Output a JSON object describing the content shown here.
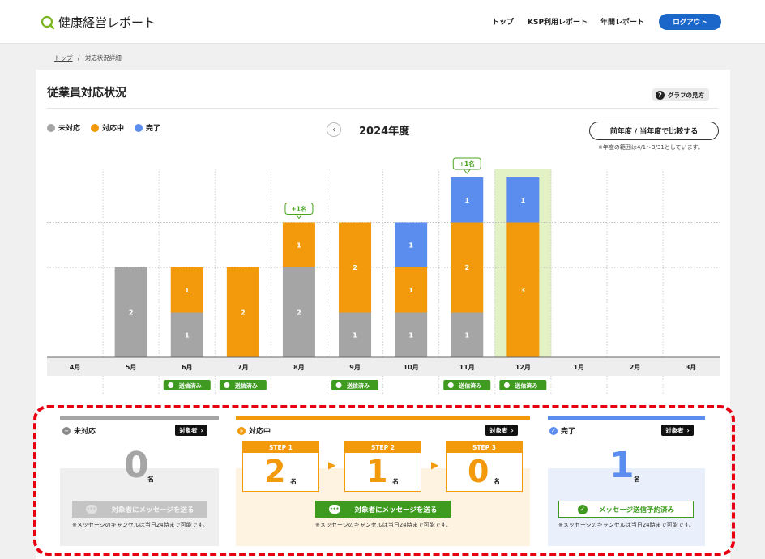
{
  "header": {
    "logo_text": "健康経営レポート",
    "nav": [
      "トップ",
      "KSP利用レポート",
      "年間レポート"
    ],
    "logout_label": "ログアウト"
  },
  "breadcrumb": {
    "top": "トップ",
    "separator": "/",
    "current": "対応状況詳細"
  },
  "page": {
    "title": "従業員対応状況",
    "help_label": "グラフの見方",
    "year_label": "2024年度",
    "compare_label": "前年度 / 当年度で比較する",
    "range_note": "※年度の範囲は4/1～3/31としています。"
  },
  "legend": [
    {
      "label": "未対応",
      "color": "#a5a5a5"
    },
    {
      "label": "対応中",
      "color": "#f29a0c"
    },
    {
      "label": "完了",
      "color": "#5b8def"
    }
  ],
  "chart_data": {
    "type": "bar",
    "stacked": true,
    "categories": [
      "4月",
      "5月",
      "6月",
      "7月",
      "8月",
      "9月",
      "10月",
      "11月",
      "12月",
      "1月",
      "2月",
      "3月"
    ],
    "series": [
      {
        "name": "未対応",
        "color": "#a5a5a5",
        "values": [
          0,
          2,
          1,
          0,
          2,
          1,
          1,
          1,
          0,
          0,
          0,
          0
        ]
      },
      {
        "name": "対応中",
        "color": "#f29a0c",
        "values": [
          0,
          0,
          1,
          2,
          1,
          2,
          1,
          2,
          3,
          0,
          0,
          0
        ]
      },
      {
        "name": "完了",
        "color": "#5b8def",
        "values": [
          0,
          0,
          0,
          0,
          0,
          0,
          1,
          1,
          1,
          0,
          0,
          0
        ]
      }
    ],
    "ylim": [
      0,
      4
    ],
    "grid": true,
    "highlight_category": "12月",
    "increase_badges": [
      {
        "category": "8月",
        "label": "+1名"
      },
      {
        "category": "11月",
        "label": "+1名"
      }
    ],
    "sent_badge_label": "送信済み",
    "sent_categories": [
      "6月",
      "7月",
      "9月",
      "11月",
      "12月"
    ]
  },
  "sections": {
    "unhandled": {
      "title": "未対応",
      "target_label": "対象者",
      "count": "0",
      "unit": "名",
      "button_label": "対象者にメッセージを送る",
      "note": "※メッセージのキャンセルは当日24時まで可能です。"
    },
    "in_progress": {
      "title": "対応中",
      "target_label": "対象者",
      "steps": [
        {
          "label": "STEP 1",
          "count": "2",
          "unit": "名"
        },
        {
          "label": "STEP 2",
          "count": "1",
          "unit": "名"
        },
        {
          "label": "STEP 3",
          "count": "0",
          "unit": "名"
        }
      ],
      "button_label": "対象者にメッセージを送る",
      "note": "※メッセージのキャンセルは当日24時まで可能です。"
    },
    "completed": {
      "title": "完了",
      "target_label": "対象者",
      "count": "1",
      "unit": "名",
      "button_label": "メッセージ送信予約済み",
      "note": "※メッセージのキャンセルは当日24時まで可能です。"
    }
  }
}
